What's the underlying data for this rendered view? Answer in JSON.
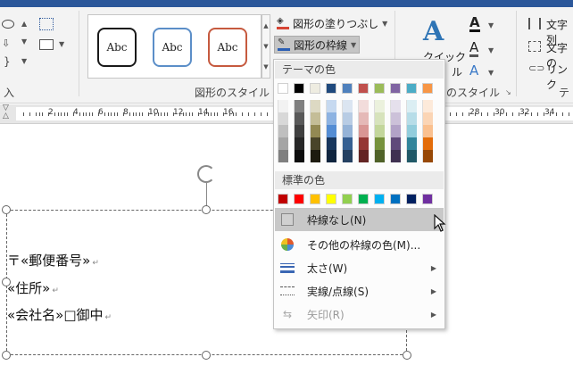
{
  "ribbon": {
    "left_group_label": "入",
    "shape_styles_label": "図形のスタイル",
    "wordart_styles_label": "のスタイル",
    "text_group_label": "テ",
    "style_box_labels": [
      "Abc",
      "Abc",
      "Abc"
    ],
    "shape_fill_label": "図形の塗りつぶし",
    "shape_outline_label": "図形の枠線",
    "quick_label_1": "クイック",
    "quick_label_2": "ル",
    "text_dir_label": "文字列",
    "align_text_label": "文字の",
    "link_label": "リンク",
    "text_icon_glyph": "A"
  },
  "ruler": {
    "labels_left": [
      "2",
      "4",
      "6",
      "8",
      "10",
      "12",
      "14",
      "16"
    ],
    "labels_right": [
      "28",
      "30",
      "32",
      "34"
    ]
  },
  "document": {
    "lines": [
      "〒«郵便番号»",
      "«住所»",
      "«会社名»□御中"
    ],
    "pilcrow": "↵"
  },
  "dropdown": {
    "theme_colors_header": "テーマの色",
    "standard_colors_header": "標準の色",
    "theme_base": [
      "#ffffff",
      "#000000",
      "#e7e6e6",
      "#44546a",
      "#4472c4",
      "#ed7d31",
      "#a5a5a5",
      "#ffc000",
      "#5b9bd5",
      "#70ad47"
    ],
    "theme_base_shown": [
      "#ffffff",
      "#000000",
      "#eeece1",
      "#1f497d",
      "#4f81bd",
      "#c0504d",
      "#9bbb59",
      "#8064a2",
      "#4bacc6",
      "#f79646"
    ],
    "theme_shades": [
      [
        "#f2f2f2",
        "#7f7f7f",
        "#ddd9c3",
        "#c6d9f0",
        "#dbe5f1",
        "#f2dcdb",
        "#ebf1dd",
        "#e5e0ec",
        "#dbeef3",
        "#fdeada"
      ],
      [
        "#d8d8d8",
        "#595959",
        "#c4bd97",
        "#8db3e2",
        "#b8cce4",
        "#e5b9b7",
        "#d7e3bc",
        "#ccc1d9",
        "#b7dde8",
        "#fbd5b5"
      ],
      [
        "#bfbfbf",
        "#3f3f3f",
        "#938953",
        "#548dd4",
        "#95b3d7",
        "#d99694",
        "#c3d69b",
        "#b2a2c7",
        "#92cddc",
        "#fac08f"
      ],
      [
        "#a5a5a5",
        "#262626",
        "#494429",
        "#17365d",
        "#366092",
        "#953734",
        "#76923c",
        "#5f497a",
        "#31859b",
        "#e36c09"
      ],
      [
        "#7f7f7f",
        "#0c0c0c",
        "#1d1b10",
        "#0f243e",
        "#244061",
        "#632423",
        "#4f6128",
        "#3f3151",
        "#205867",
        "#974806"
      ]
    ],
    "standard": [
      "#c00000",
      "#ff0000",
      "#ffc000",
      "#ffff00",
      "#92d050",
      "#00b050",
      "#00b0f0",
      "#0070c0",
      "#002060",
      "#7030a0"
    ],
    "items": {
      "no_outline": "枠線なし(N)",
      "more_colors": "その他の枠線の色(M)...",
      "weight": "太さ(W)",
      "dashes": "実線/点線(S)",
      "arrows": "矢印(R)"
    }
  }
}
